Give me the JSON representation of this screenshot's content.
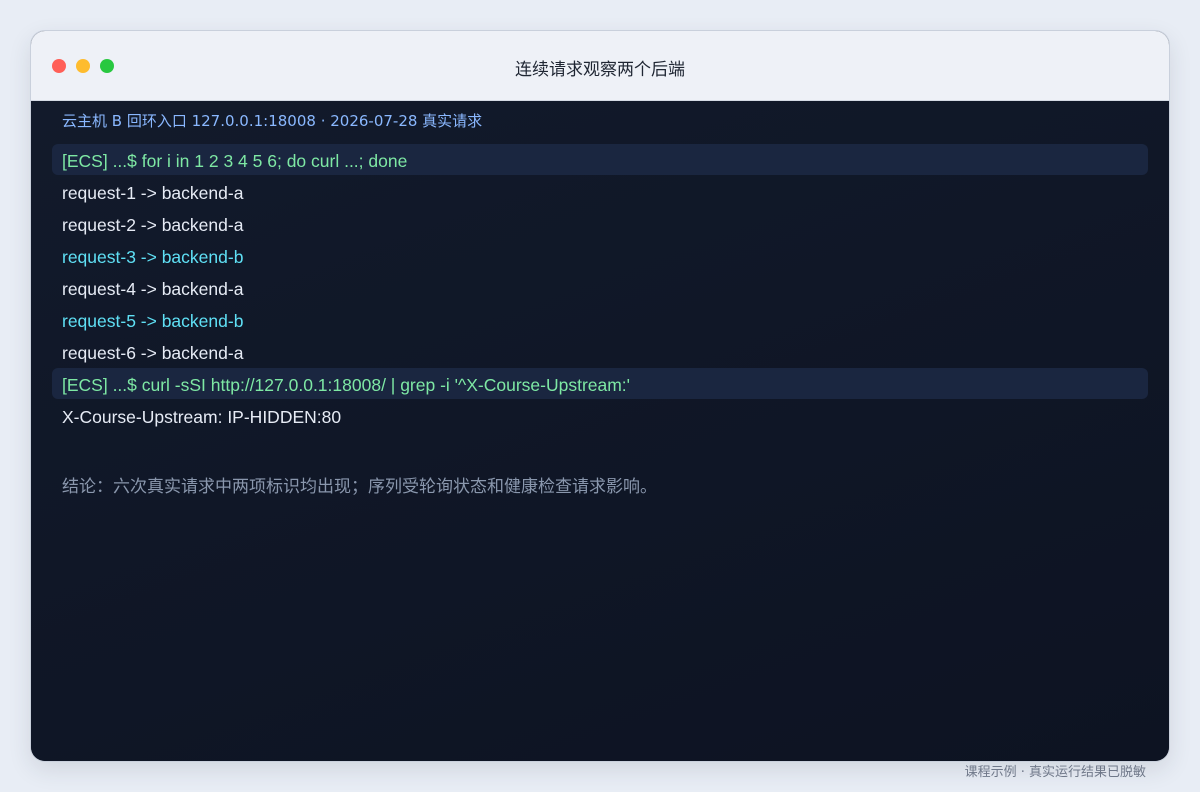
{
  "window": {
    "title": "连续请求观察两个后端"
  },
  "terminal": {
    "host_info": "云主机 B 回环入口 127.0.0.1:18008 · 2026-07-28 真实请求",
    "commands": [
      "[ECS] ...$ for i in 1 2 3 4 5 6; do curl ...; done",
      "[ECS] ...$ curl -sSI http://127.0.0.1:18008/ | grep -i '^X-Course-Upstream:'"
    ],
    "requests": [
      "request-1 -> backend-a",
      "request-2 -> backend-a",
      "request-3 -> backend-b",
      "request-4 -> backend-a",
      "request-5 -> backend-b",
      "request-6 -> backend-a"
    ],
    "header_output": "X-Course-Upstream: IP-HIDDEN:80",
    "conclusion": "结论：六次真实请求中两项标识均出现；序列受轮询状态和健康检查请求影响。"
  },
  "footer": {
    "note": "课程示例 · 真实运行结果已脱敏"
  },
  "colors": {
    "command": "#7ee8a4",
    "output": "#e6ebf5",
    "backend_b_highlight": "#5fe0f5",
    "host_info": "#8ab8ff",
    "terminal_bg": "#0f1524"
  }
}
